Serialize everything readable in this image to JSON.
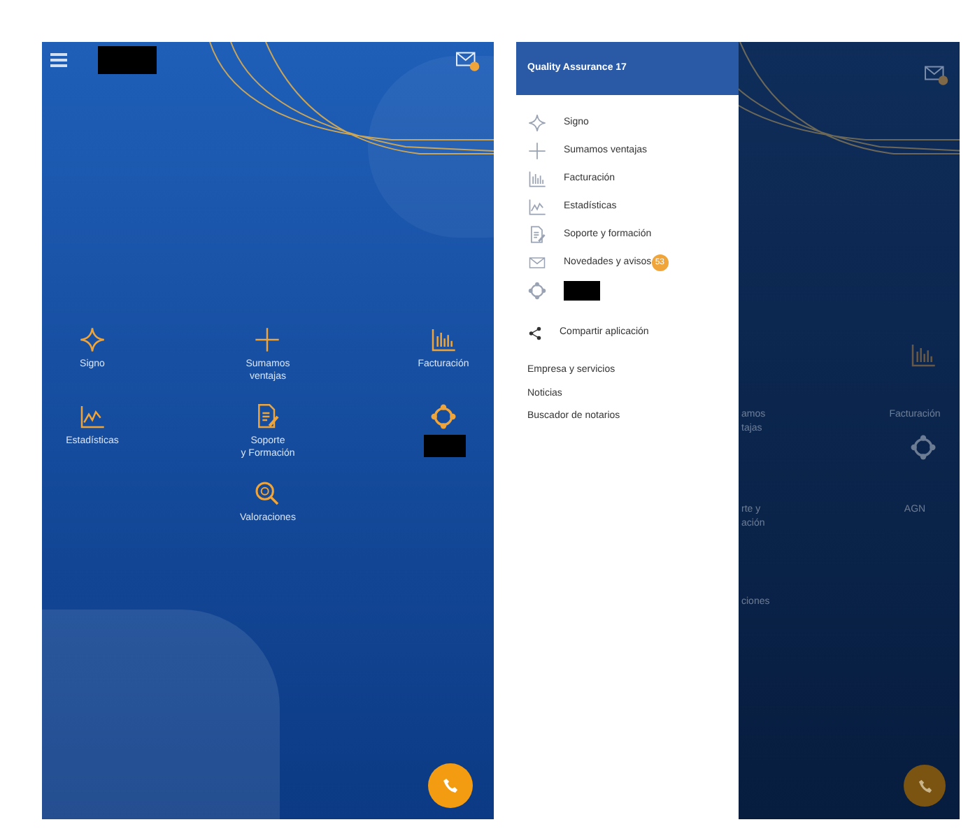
{
  "home_screen": {
    "tiles": [
      {
        "kind": "tile",
        "label": "Signo"
      },
      {
        "kind": "tile",
        "label": "Sumamos ventajas"
      },
      {
        "kind": "tile",
        "label": "Facturación"
      },
      {
        "kind": "tile",
        "label": "Estadísticas"
      },
      {
        "kind": "tile",
        "label": "Soporte y Formación"
      },
      {
        "kind": "redacted"
      },
      {
        "kind": "tile",
        "label": "Valoraciones"
      }
    ]
  },
  "drawer_screen": {
    "header": "Quality Assurance 17",
    "items": [
      {
        "kind": "item",
        "label": "Signo"
      },
      {
        "kind": "item",
        "label": "Sumamos ventajas"
      },
      {
        "kind": "item",
        "label": "Facturación"
      },
      {
        "kind": "item",
        "label": "Estadísticas"
      },
      {
        "kind": "item",
        "label": "Soporte y formación"
      },
      {
        "kind": "item",
        "label": "Novedades y avisos",
        "badge": "53"
      },
      {
        "kind": "redacted"
      }
    ],
    "share": {
      "label": "Compartir aplicación"
    },
    "links": [
      "Empresa y servicios",
      "Noticias",
      "Buscador de notarios"
    ],
    "background_labels": [
      "amos",
      "Facturación",
      "tajas",
      "rte y",
      "AGN",
      "ación",
      "ciones"
    ]
  }
}
